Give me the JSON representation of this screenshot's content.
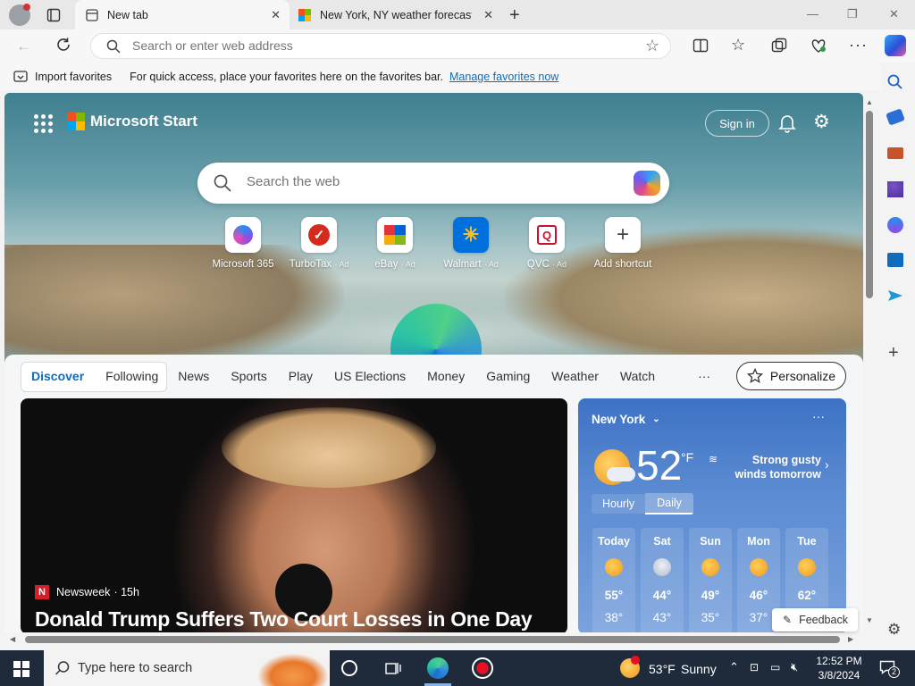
{
  "tabs": [
    {
      "title": "New tab",
      "active": true
    },
    {
      "title": "New York, NY weather forecast |",
      "active": false
    }
  ],
  "address_bar": {
    "placeholder": "Search or enter web address"
  },
  "favorites_bar": {
    "import_label": "Import favorites",
    "hint_text": "For quick access, place your favorites here on the favorites bar.",
    "manage_link": "Manage favorites now"
  },
  "start": {
    "logo_text": "Microsoft Start",
    "sign_in": "Sign in",
    "search_placeholder": "Search the web"
  },
  "shortcuts": [
    {
      "label": "Microsoft 365",
      "ad": ""
    },
    {
      "label": "TurboTax",
      "ad": "· Ad"
    },
    {
      "label": "eBay",
      "ad": "· Ad"
    },
    {
      "label": "Walmart",
      "ad": "· Ad"
    },
    {
      "label": "QVC",
      "ad": "· Ad"
    },
    {
      "label": "Add shortcut",
      "ad": ""
    }
  ],
  "feed_nav": [
    "Discover",
    "Following",
    "News",
    "Sports",
    "Play",
    "US Elections",
    "Money",
    "Gaming",
    "Weather",
    "Watch"
  ],
  "feed_more": "···",
  "personalize": "Personalize",
  "news_card": {
    "source": "Newsweek",
    "age": "· 15h",
    "headline": "Donald Trump Suffers Two Court Losses in One Day"
  },
  "weather": {
    "location": "New York",
    "temp": "52",
    "unit": "°F",
    "alert": "Strong gusty winds tomorrow",
    "tab_hourly": "Hourly",
    "tab_daily": "Daily",
    "days": [
      {
        "name": "Today",
        "hi": "55°",
        "lo": "38°"
      },
      {
        "name": "Sat",
        "hi": "44°",
        "lo": "43°"
      },
      {
        "name": "Sun",
        "hi": "49°",
        "lo": "35°"
      },
      {
        "name": "Mon",
        "hi": "46°",
        "lo": "37°"
      },
      {
        "name": "Tue",
        "hi": "62°",
        "lo": ""
      }
    ]
  },
  "feedback": "Feedback",
  "taskbar": {
    "search_placeholder": "Type here to search",
    "weather_temp": "53°F",
    "weather_cond": "Sunny",
    "time": "12:52 PM",
    "date": "3/8/2024",
    "notification_count": "2"
  }
}
